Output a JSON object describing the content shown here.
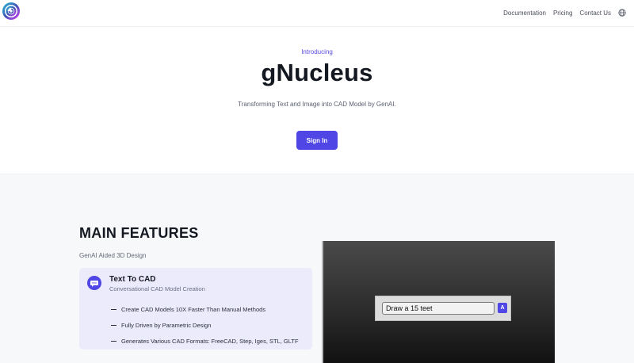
{
  "header": {
    "logo_icon": "spiral-logo-icon",
    "nav": [
      {
        "label": "Documentation"
      },
      {
        "label": "Pricing"
      },
      {
        "label": "Contact Us"
      }
    ],
    "language_icon": "globe-icon"
  },
  "hero": {
    "intro": "Introducing",
    "title": "gNucleus",
    "subtitle": "Transforming Text and Image into CAD Model by GenAI.",
    "signin_label": "Sign In"
  },
  "features": {
    "title": "MAIN FEATURES",
    "subtitle": "GenAI Aided 3D Design",
    "card": {
      "icon": "chat-bubble-icon",
      "title": "Text To CAD",
      "subtitle": "Conversational CAD Model Creation",
      "bullets": [
        "Create CAD Models 10X Faster Than Manual Methods",
        "Fully Driven by Parametric Design",
        "Generates Various CAD Formats: FreeCAD, Step, Iges, STL, GLTF"
      ]
    },
    "demo": {
      "prompt_value": "Draw a 15 teet",
      "submit_label": "A"
    }
  },
  "colors": {
    "accent": "#4f46e5",
    "intro_text": "#5b4ddb",
    "card_bg": "#ecebfb",
    "section_bg": "#f7f8fa"
  }
}
